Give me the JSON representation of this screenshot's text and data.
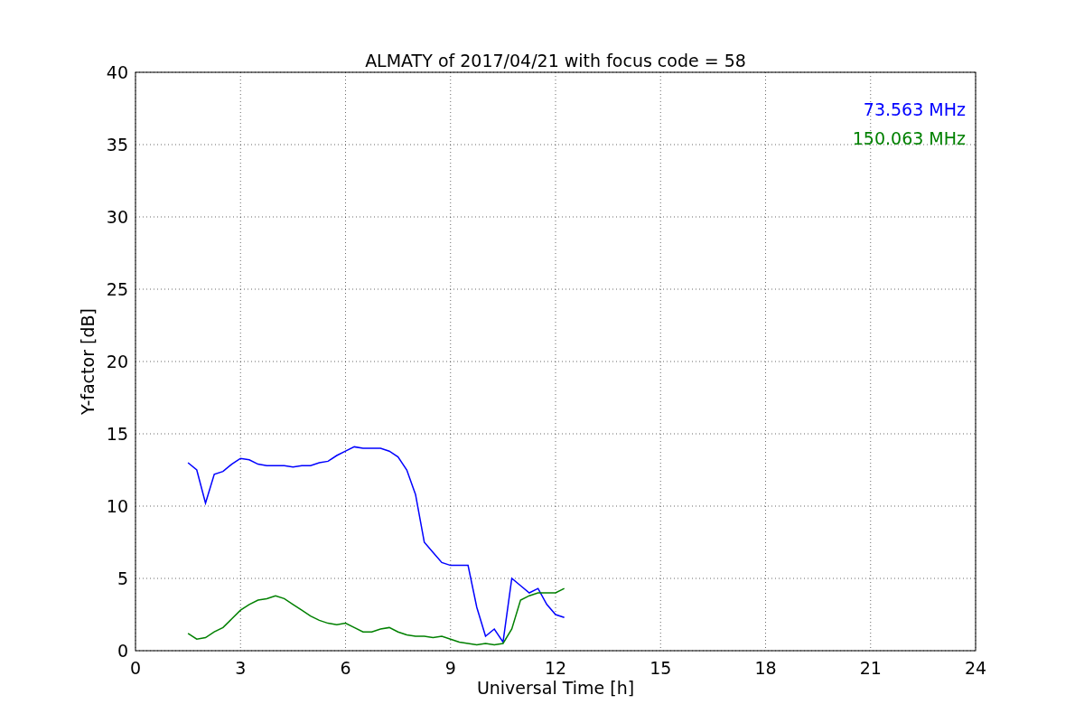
{
  "figure": {
    "chart_data": {
      "type": "line",
      "title": "ALMATY of 2017/04/21 with focus code = 58",
      "xlabel": "Universal Time [h]",
      "ylabel": "Y-factor [dB]",
      "x": [
        1.5,
        1.75,
        2,
        2.25,
        2.5,
        2.75,
        3,
        3.25,
        3.5,
        3.75,
        4,
        4.25,
        4.5,
        4.75,
        5,
        5.25,
        5.5,
        5.75,
        6,
        6.25,
        6.5,
        6.75,
        7,
        7.25,
        7.5,
        7.75,
        8,
        8.25,
        8.5,
        8.75,
        9,
        9.25,
        9.5,
        9.75,
        10,
        10.25,
        10.5,
        10.75,
        11,
        11.25,
        11.5,
        11.75,
        12,
        12.25
      ],
      "series": [
        {
          "name": "73.563 MHz",
          "color": "#0000ff",
          "values": [
            13,
            12.5,
            10.2,
            12.2,
            12.4,
            12.9,
            13.3,
            13.2,
            12.9,
            12.8,
            12.8,
            12.8,
            12.7,
            12.8,
            12.8,
            13.0,
            13.1,
            13.5,
            13.8,
            14.1,
            14,
            14,
            14,
            13.8,
            13.4,
            12.5,
            10.8,
            7.5,
            6.8,
            6.1,
            5.9,
            5.9,
            5.9,
            3,
            1,
            1.5,
            0.6,
            5,
            4.5,
            4,
            4.3,
            3.2,
            2.5,
            2.3
          ]
        },
        {
          "name": "150.063 MHz",
          "color": "#008000",
          "values": [
            1.2,
            0.8,
            0.9,
            1.3,
            1.6,
            2.2,
            2.8,
            3.2,
            3.5,
            3.6,
            3.8,
            3.6,
            3.2,
            2.8,
            2.4,
            2.1,
            1.9,
            1.8,
            1.9,
            1.6,
            1.3,
            1.3,
            1.5,
            1.6,
            1.3,
            1.1,
            1.0,
            1.0,
            0.9,
            1.0,
            0.8,
            0.6,
            0.5,
            0.4,
            0.5,
            0.4,
            0.5,
            1.5,
            3.5,
            3.8,
            4.0,
            4.0,
            4.0,
            4.3
          ]
        }
      ],
      "grid": true,
      "xlim": [
        0,
        24
      ],
      "ylim": [
        0,
        40
      ],
      "xticks": [
        0,
        3,
        6,
        9,
        12,
        15,
        18,
        21,
        24
      ],
      "yticks": [
        0,
        5,
        10,
        15,
        20,
        25,
        30,
        35,
        40
      ]
    }
  }
}
